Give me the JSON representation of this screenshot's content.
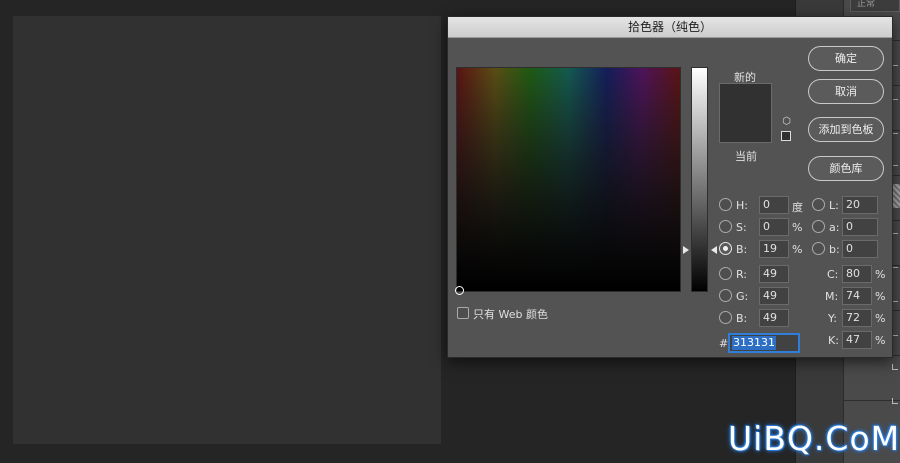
{
  "background": {
    "canvas_color": "#313131"
  },
  "right_panel": {
    "blend_mode": "正常"
  },
  "dialog": {
    "title": "拾色器（纯色）",
    "new_label": "新的",
    "current_label": "当前",
    "new_color": "#313131",
    "buttons": {
      "ok": "确定",
      "cancel": "取消",
      "add_to_swatches": "添加到色板",
      "color_libraries": "颜色库"
    },
    "web_only_label": "只有 Web 颜色",
    "hsb": {
      "h": {
        "label": "H:",
        "value": "0",
        "unit": "度"
      },
      "s": {
        "label": "S:",
        "value": "0",
        "unit": "%"
      },
      "b": {
        "label": "B:",
        "value": "19",
        "unit": "%"
      }
    },
    "rgb": {
      "r": {
        "label": "R:",
        "value": "49"
      },
      "g": {
        "label": "G:",
        "value": "49"
      },
      "b": {
        "label": "B:",
        "value": "49"
      }
    },
    "lab": {
      "l": {
        "label": "L:",
        "value": "20"
      },
      "a": {
        "label": "a:",
        "value": "0"
      },
      "b": {
        "label": "b:",
        "value": "0"
      }
    },
    "cmyk": {
      "c": {
        "label": "C:",
        "value": "80",
        "unit": "%"
      },
      "m": {
        "label": "M:",
        "value": "74",
        "unit": "%"
      },
      "y": {
        "label": "Y:",
        "value": "72",
        "unit": "%"
      },
      "k": {
        "label": "K:",
        "value": "47",
        "unit": "%"
      }
    },
    "hex": {
      "label": "#",
      "value": "313131"
    }
  },
  "watermark": "UiBQ.CoM"
}
